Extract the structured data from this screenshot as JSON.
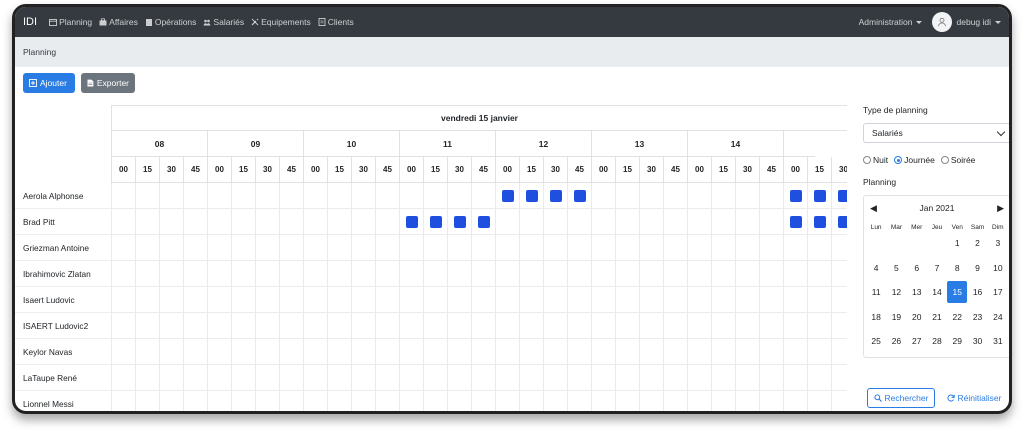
{
  "navbar": {
    "brand": "IDI",
    "items": [
      {
        "label": "Planning",
        "icon": "calendar-icon"
      },
      {
        "label": "Affaires",
        "icon": "briefcase-icon"
      },
      {
        "label": "Opérations",
        "icon": "clipboard-icon"
      },
      {
        "label": "Salariés",
        "icon": "users-icon"
      },
      {
        "label": "Equipements",
        "icon": "tools-icon"
      },
      {
        "label": "Clients",
        "icon": "address-book-icon"
      }
    ],
    "admin": "Administration",
    "user": "debug idi"
  },
  "breadcrumb": "Planning",
  "toolbar": {
    "add": "Ajouter",
    "export": "Exporter"
  },
  "planning": {
    "day": "vendredi 15 janvier",
    "hours": [
      "08",
      "09",
      "10",
      "11",
      "12",
      "13",
      "14"
    ],
    "minutes": [
      "00",
      "15",
      "30",
      "45",
      "00",
      "15",
      "30",
      "45",
      "00",
      "15",
      "30",
      "45",
      "00",
      "15",
      "30",
      "45",
      "00",
      "15",
      "30",
      "45",
      "00",
      "15",
      "30",
      "45",
      "00",
      "15",
      "30",
      "45",
      "00",
      "15",
      "30"
    ],
    "rows": [
      {
        "name": "Aerola Alphonse",
        "slots": [
          16,
          17,
          18,
          19,
          28,
          29,
          30
        ]
      },
      {
        "name": "Brad Pitt",
        "slots": [
          12,
          13,
          14,
          15,
          28,
          29,
          30
        ]
      },
      {
        "name": "Griezman Antoine",
        "slots": []
      },
      {
        "name": "Ibrahimovic Zlatan",
        "slots": []
      },
      {
        "name": "Isaert Ludovic",
        "slots": []
      },
      {
        "name": "ISAERT Ludovic2",
        "slots": []
      },
      {
        "name": "Keylor Navas",
        "slots": []
      },
      {
        "name": "LaTaupe René",
        "slots": []
      },
      {
        "name": "Lionnel Messi",
        "slots": []
      }
    ],
    "slot_color": "#1f4fdf"
  },
  "panel": {
    "type_label": "Type de planning",
    "type_value": "Salariés",
    "radios": [
      {
        "label": "Nuit",
        "checked": false
      },
      {
        "label": "Journée",
        "checked": true
      },
      {
        "label": "Soirée",
        "checked": false
      }
    ],
    "planning_label": "Planning",
    "calendar": {
      "month": "Jan 2021",
      "weekdays": [
        "Lun",
        "Mar",
        "Mer",
        "Jeu",
        "Ven",
        "Sam",
        "Dim"
      ],
      "weeks": [
        [
          "",
          "",
          "",
          "",
          "1",
          "2",
          "3"
        ],
        [
          "4",
          "5",
          "6",
          "7",
          "8",
          "9",
          "10"
        ],
        [
          "11",
          "12",
          "13",
          "14",
          "15",
          "16",
          "17"
        ],
        [
          "18",
          "19",
          "20",
          "21",
          "22",
          "23",
          "24"
        ],
        [
          "25",
          "26",
          "27",
          "28",
          "29",
          "30",
          "31"
        ]
      ],
      "selected": "15"
    },
    "search": "Rechercher",
    "reset": "Réinitialiser"
  },
  "accent": "#2a7ce5"
}
